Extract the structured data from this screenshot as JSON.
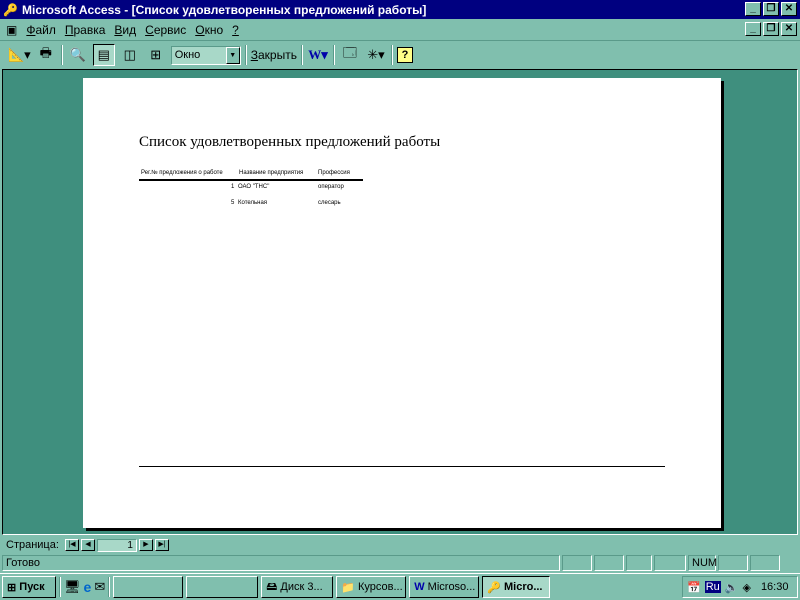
{
  "window": {
    "title": "Microsoft Access - [Список удовлетворенных предложений работы]"
  },
  "menu": [
    {
      "hot": "Ф",
      "rest": "айл"
    },
    {
      "hot": "П",
      "rest": "равка"
    },
    {
      "hot": "В",
      "rest": "ид"
    },
    {
      "hot": "С",
      "rest": "ервис"
    },
    {
      "hot": "О",
      "rest": "кно"
    },
    {
      "hot": "?",
      "rest": ""
    }
  ],
  "toolbar": {
    "zoom_value": "Окно",
    "close_hot": "З",
    "close_rest": "акрыть"
  },
  "report": {
    "title": "Список удовлетворенных предложений работы",
    "columns": [
      "Рег.№ предложения о работе",
      "Название предприятия",
      "Профессия"
    ],
    "rows": [
      {
        "id": "1",
        "company": "ОАО \"ТНС\"",
        "profession": "оператор"
      },
      {
        "id": "5",
        "company": "Котельная",
        "profession": "слесарь"
      }
    ]
  },
  "nav": {
    "label": "Страница:",
    "page": "1"
  },
  "status": {
    "text": "Готово",
    "num": "NUM"
  },
  "taskbar": {
    "start": "Пуск",
    "items": [
      "",
      "",
      "Диск 3...",
      "Курсов...",
      "Microso...",
      "Micro..."
    ],
    "clock": "16:30",
    "lang": "Ru"
  }
}
